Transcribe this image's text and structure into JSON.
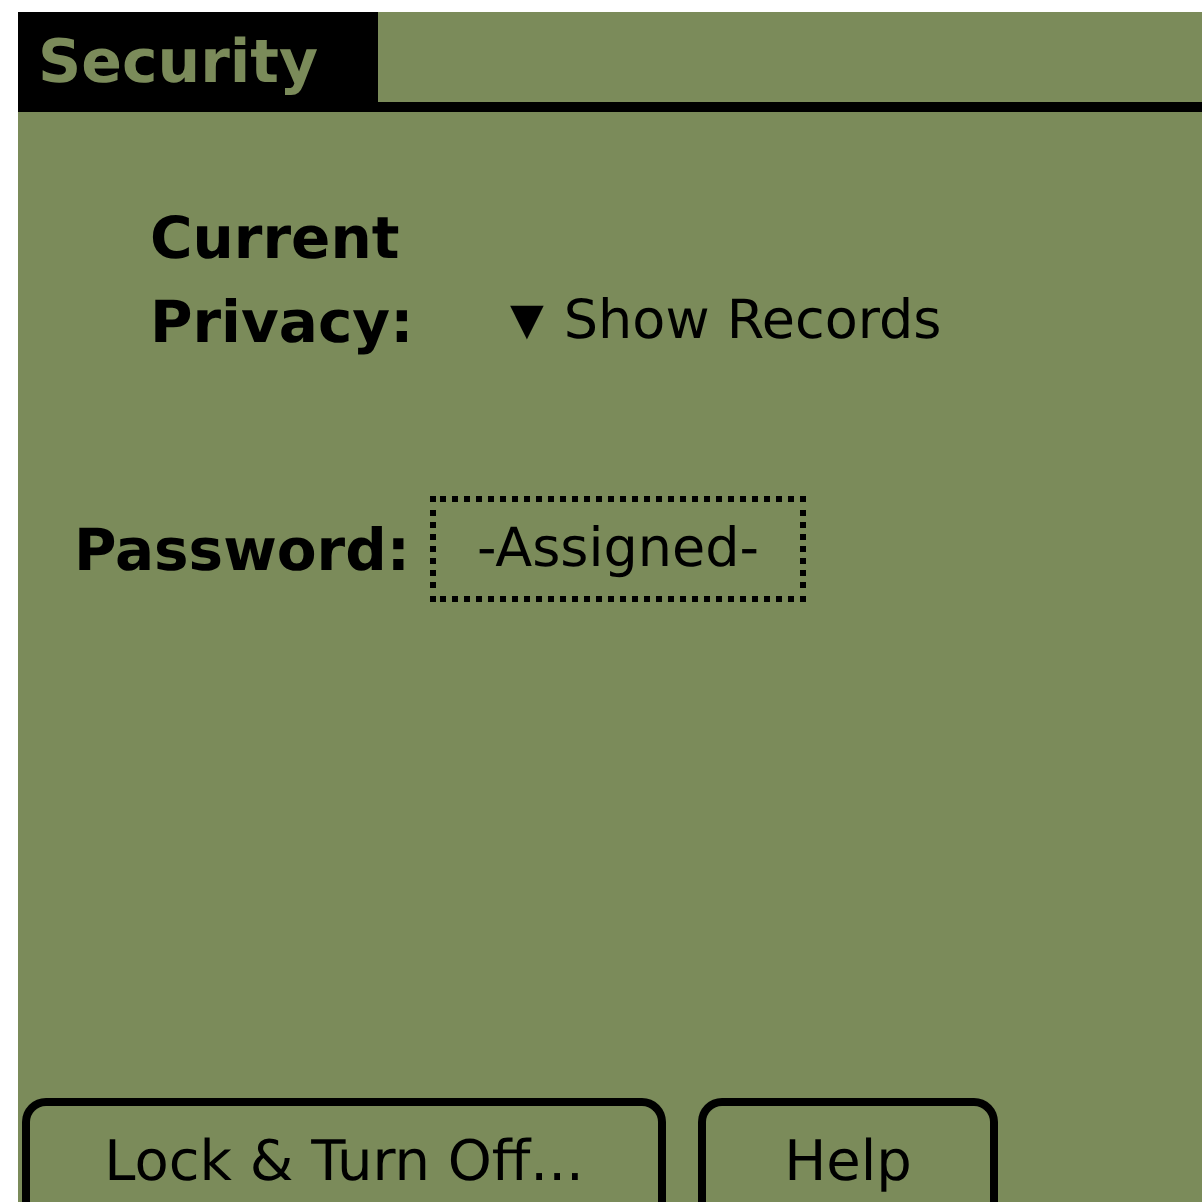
{
  "form": {
    "title": "Security"
  },
  "privacy": {
    "label": "Current Privacy:",
    "trigger": "▼",
    "value": "Show Records"
  },
  "password": {
    "label": "Password:",
    "value": "-Assigned-"
  },
  "buttons": [
    "Lock & Turn Off...",
    "Help"
  ]
}
